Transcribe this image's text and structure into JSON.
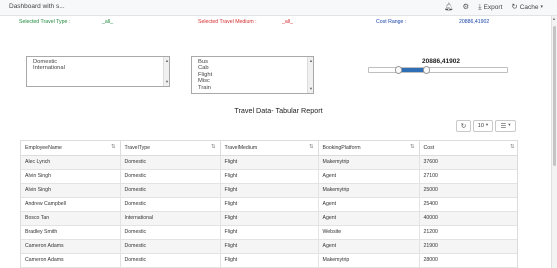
{
  "header": {
    "title": "Dashboard with s...",
    "export_label": "Export",
    "cache_label": "Cache"
  },
  "filters": {
    "travel_type_label": "Selected Travel Type :",
    "travel_type_value": "_all_",
    "travel_medium_label": "Selected Travel Medium :",
    "travel_medium_value": "_all_",
    "cost_range_label": "Cost Range :",
    "cost_range_value": "20886,41902"
  },
  "travel_type_list": [
    "Domestic",
    "International"
  ],
  "travel_medium_list": [
    "Bus",
    "Cab",
    "Flight",
    "Misc",
    "Train"
  ],
  "cost_slider": {
    "value_label": "20886,41902",
    "low_fraction": 0.22,
    "high_fraction": 0.42
  },
  "report": {
    "title": "Travel Data- Tabular Report",
    "page_size": "10",
    "columns": [
      "EmployeeName",
      "TravelType",
      "TravelMedium",
      "BookingPlatform",
      "Cost"
    ],
    "rows": [
      [
        "Alec Lynch",
        "Domestic",
        "Flight",
        "Makemytrip",
        "37600"
      ],
      [
        "Alvin Singh",
        "Domestic",
        "Flight",
        "Agent",
        "27100"
      ],
      [
        "Alvin Singh",
        "Domestic",
        "Flight",
        "Makemytrip",
        "25000"
      ],
      [
        "Andrew Campbell",
        "Domestic",
        "Flight",
        "Agent",
        "25400"
      ],
      [
        "Bosco Tan",
        "International",
        "Flight",
        "Agent",
        "40000"
      ],
      [
        "Bradley Smith",
        "Domestic",
        "Flight",
        "Website",
        "21200"
      ],
      [
        "Cameron Adams",
        "Domestic",
        "Flight",
        "Agent",
        "21900"
      ],
      [
        "Cameron Adams",
        "Domestic",
        "Flight",
        "Makemytrip",
        "28000"
      ]
    ]
  }
}
